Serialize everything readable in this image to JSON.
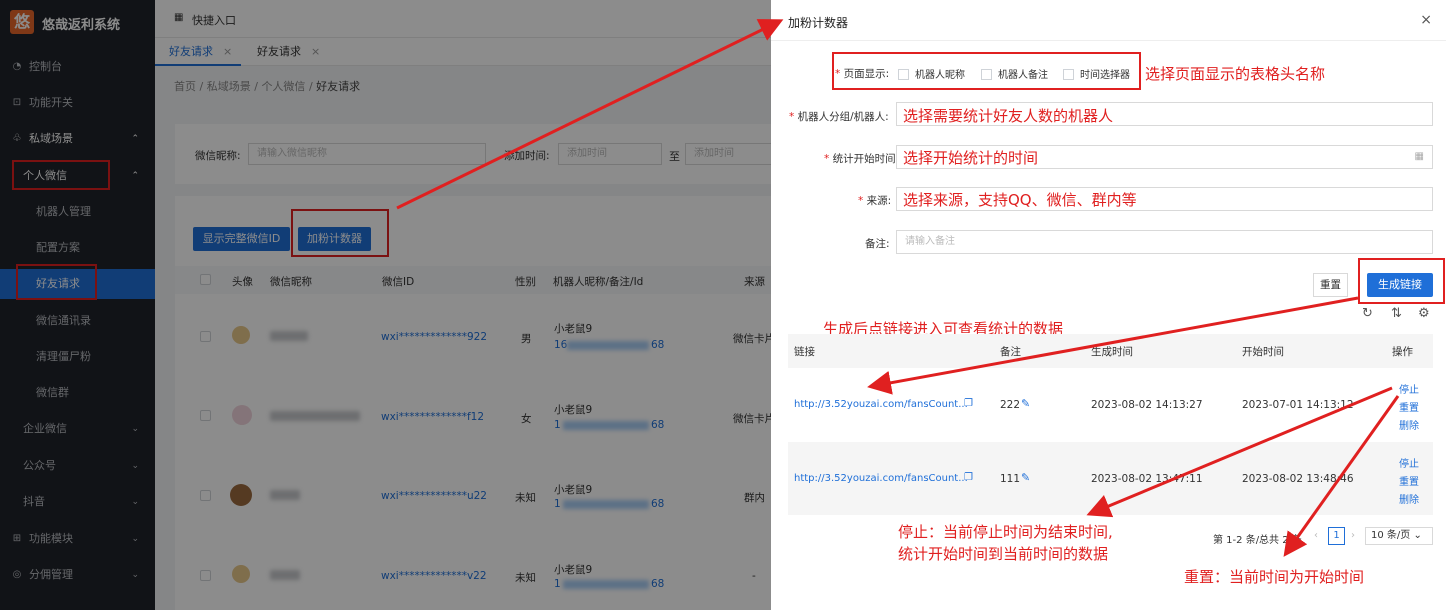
{
  "app": {
    "logo_char": "悠",
    "name": "悠哉返利系统"
  },
  "sidebar": {
    "items": [
      {
        "label": "控制台",
        "icon": "dashboard-icon",
        "glyph": "◔"
      },
      {
        "label": "功能开关",
        "icon": "switch-icon",
        "glyph": "⊡"
      },
      {
        "label": "私域场景",
        "icon": "scene-icon",
        "glyph": "♧",
        "chev": "⌃"
      },
      {
        "label": "个人微信",
        "chev": "⌃"
      },
      {
        "label": "机器人管理"
      },
      {
        "label": "配置方案"
      },
      {
        "label": "好友请求"
      },
      {
        "label": "微信通讯录"
      },
      {
        "label": "清理僵尸粉"
      },
      {
        "label": "微信群"
      },
      {
        "label": "企业微信",
        "chev": "⌄"
      },
      {
        "label": "公众号",
        "chev": "⌄"
      },
      {
        "label": "抖音",
        "chev": "⌄"
      },
      {
        "label": "功能模块",
        "icon": "module-icon",
        "glyph": "⊞",
        "chev": "⌄"
      },
      {
        "label": "分佣管理",
        "icon": "commission-icon",
        "glyph": "◎",
        "chev": "⌄"
      }
    ]
  },
  "topbar": {
    "quick_entry": "快捷入口",
    "grid_glyph": "▦"
  },
  "tabs": [
    {
      "label": "好友请求",
      "close": "×"
    },
    {
      "label": "好友请求",
      "close": "×"
    }
  ],
  "breadcrumb": {
    "items": [
      "首页",
      "私域场景",
      "个人微信"
    ],
    "sep": "/",
    "current": "好友请求"
  },
  "filter": {
    "nickname_label": "微信昵称:",
    "nickname_placeholder": "请输入微信昵称",
    "time_label": "添加时间:",
    "start_placeholder": "添加时间",
    "to": "至",
    "end_placeholder": "添加时间"
  },
  "toolbar": {
    "show_id": "显示完整微信ID",
    "fans_counter": "加粉计数器"
  },
  "table": {
    "headers": [
      "头像",
      "微信昵称",
      "微信ID",
      "性别",
      "机器人昵称/备注/Id",
      "来源"
    ],
    "rows": [
      {
        "wxid": "wxi*************922",
        "gender": "男",
        "robot": "小老鼠9",
        "robot_id_a": "16",
        "robot_id_b": "68",
        "source": "微信卡片"
      },
      {
        "wxid": "wxi*************f12",
        "gender": "女",
        "robot": "小老鼠9",
        "robot_id_a": "1",
        "robot_id_b": "68",
        "source": "微信卡片"
      },
      {
        "wxid": "wxi*************u22",
        "gender": "未知",
        "robot": "小老鼠9",
        "robot_id_a": "1",
        "robot_id_b": "68",
        "source": "群内"
      },
      {
        "wxid": "wxi*************v22",
        "gender": "未知",
        "robot": "小老鼠9",
        "robot_id_a": "1",
        "robot_id_b": "68",
        "source": "-"
      }
    ]
  },
  "drawer": {
    "title": "加粉计数器",
    "close": "×",
    "page_display_label": "页面显示:",
    "checkboxes": [
      "机器人昵称",
      "机器人备注",
      "时间选择器"
    ],
    "robot_label": "机器人分组/机器人:",
    "start_label": "统计开始时间:",
    "source_label": "来源:",
    "remark_label": "备注:",
    "remark_placeholder": "请输入备注",
    "reset": "重置",
    "generate": "生成链接",
    "tool_glyphs": [
      "↻",
      "⇅",
      "⚙"
    ],
    "list_headers": [
      "链接",
      "备注",
      "生成时间",
      "开始时间",
      "操作"
    ],
    "rows": [
      {
        "link": "http://3.52youzai.com/fansCount...",
        "remark": "222",
        "created": "2023-08-02 14:13:27",
        "start": "2023-07-01 14:13:12",
        "ops": [
          "停止",
          "重置",
          "删除"
        ]
      },
      {
        "link": "http://3.52youzai.com/fansCount...",
        "remark": "111",
        "created": "2023-08-02 13:47:11",
        "start": "2023-08-02 13:48:46",
        "ops": [
          "停止",
          "重置",
          "删除"
        ]
      }
    ],
    "pagination": {
      "summary": "第 1-2 条/总共 2 条",
      "page": "1",
      "size": "10 条/页"
    }
  },
  "annotations": {
    "header": "选择页面显示的表格头名称",
    "robot": "选择需要统计好友人数的机器人",
    "start": "选择开始统计的时间",
    "source": "选择来源，支持QQ、微信、群内等",
    "link": "生成后点链接进入可查看统计的数据",
    "stop1": "停止：当前停止时间为结束时间,",
    "stop2": "统计开始时间到当前时间的数据",
    "reset": "重置：当前时间为开始时间"
  },
  "colors": {
    "accent": "#1f6fd8",
    "annotation": "#e02020",
    "sidebar": "#20232a"
  }
}
